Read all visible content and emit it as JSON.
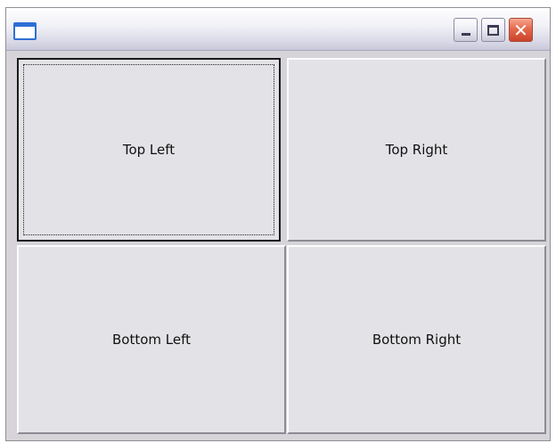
{
  "window": {
    "title": "",
    "controls": {
      "minimize_icon": "minimize-icon",
      "maximize_icon": "maximize-icon",
      "close_icon": "close-icon",
      "close_glyph": "✕"
    }
  },
  "buttons": {
    "top_left": "Top Left",
    "top_right": "Top Right",
    "bottom_left": "Bottom Left",
    "bottom_right": "Bottom Right"
  },
  "colors": {
    "close_button": "#e6694c",
    "title_icon": "#2f6fd6",
    "button_face": "#e3e2e6"
  }
}
